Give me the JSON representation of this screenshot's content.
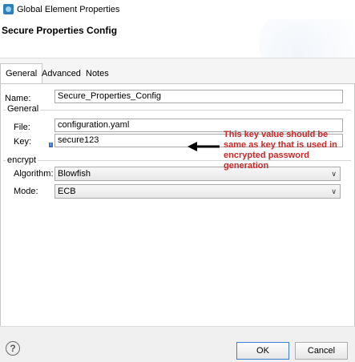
{
  "window": {
    "title": "Global Element Properties"
  },
  "header": {
    "title": "Secure Properties Config"
  },
  "tabs": [
    {
      "label": "General",
      "active": true
    },
    {
      "label": "Advanced",
      "active": false
    },
    {
      "label": "Notes",
      "active": false
    }
  ],
  "form": {
    "name_label": "Name:",
    "name_value": "Secure_Properties_Config",
    "general_group": "General",
    "file_label": "File:",
    "file_value": "configuration.yaml",
    "key_label": "Key:",
    "key_value": "secure123",
    "encrypt_group": "encrypt",
    "algorithm_label": "Algorithm:",
    "algorithm_value": "Blowfish",
    "mode_label": "Mode:",
    "mode_value": "ECB"
  },
  "annotation": {
    "text": "This key value should be same as key that is used in encrypted password generation",
    "color": "#d02626"
  },
  "footer": {
    "help_icon": "?",
    "ok_label": "OK",
    "cancel_label": "Cancel"
  }
}
